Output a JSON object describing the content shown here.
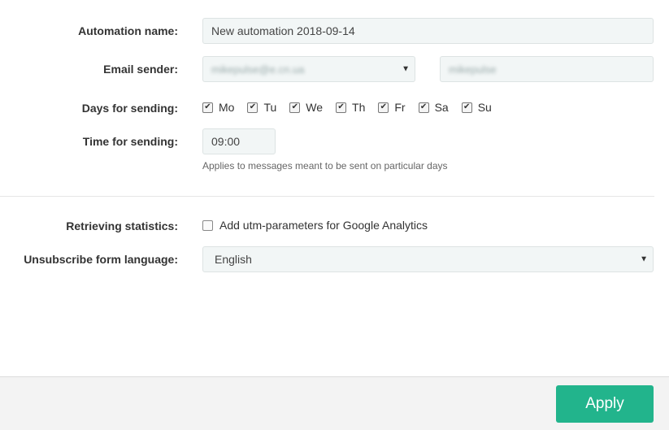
{
  "form": {
    "automation_name_label": "Automation name:",
    "automation_name_value": "New automation 2018-09-14",
    "email_sender_label": "Email sender:",
    "email_sender_value": "mikepulse@e.cn.ua",
    "sender_name_value": "mikepulse",
    "days_label": "Days for sending:",
    "days": [
      {
        "label": "Mo",
        "checked": true
      },
      {
        "label": "Tu",
        "checked": true
      },
      {
        "label": "We",
        "checked": true
      },
      {
        "label": "Th",
        "checked": true
      },
      {
        "label": "Fr",
        "checked": true
      },
      {
        "label": "Sa",
        "checked": true
      },
      {
        "label": "Su",
        "checked": true
      }
    ],
    "time_label": "Time for sending:",
    "time_value": "09:00",
    "time_hint": "Applies to messages meant to be sent on particular days",
    "stats_label": "Retrieving statistics:",
    "utm_label": "Add utm-parameters for Google Analytics",
    "utm_checked": false,
    "language_label": "Unsubscribe form language:",
    "language_value": "English"
  },
  "footer": {
    "apply_label": "Apply",
    "accent_color": "#22b48c"
  }
}
